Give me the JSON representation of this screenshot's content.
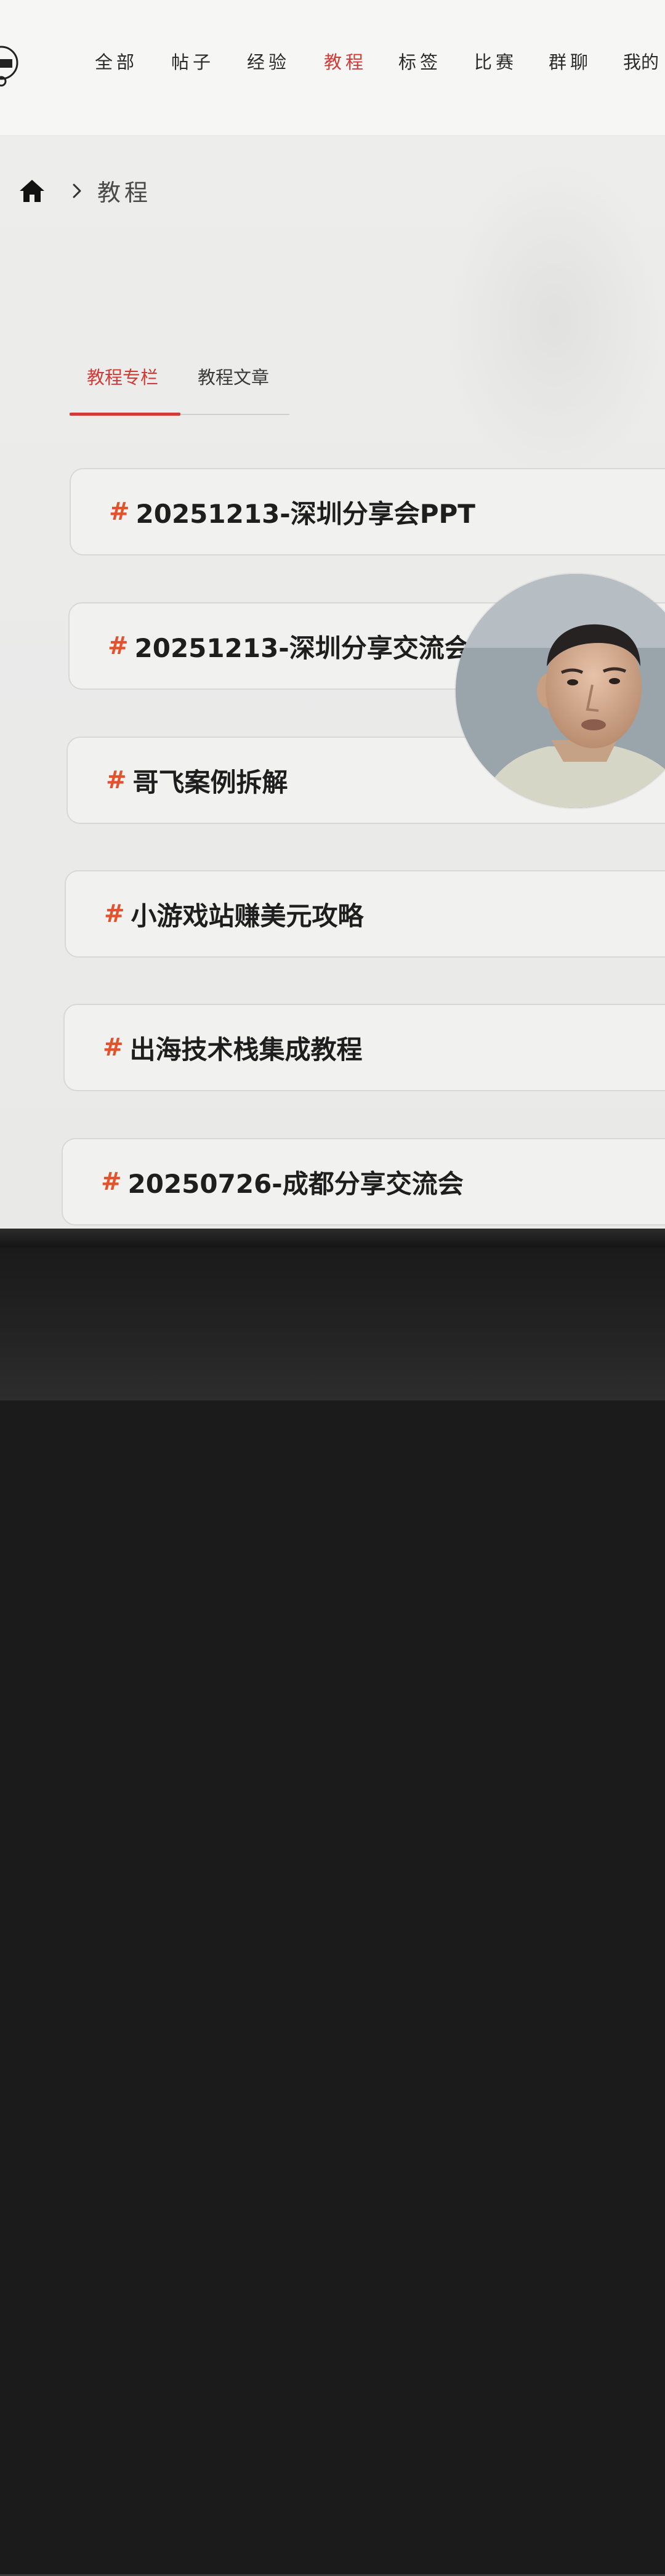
{
  "nav": {
    "items": [
      {
        "label": "全部",
        "active": false
      },
      {
        "label": "帖子",
        "active": false
      },
      {
        "label": "经验",
        "active": false
      },
      {
        "label": "教程",
        "active": true
      },
      {
        "label": "标签",
        "active": false
      },
      {
        "label": "比赛",
        "active": false
      },
      {
        "label": "群聊",
        "active": false
      },
      {
        "label": "我的",
        "active": false
      }
    ]
  },
  "breadcrumb": {
    "home_icon": "home-icon",
    "separator_icon": "chevron-right-icon",
    "current": "教程"
  },
  "tabs": [
    {
      "label": "教程专栏",
      "active": true
    },
    {
      "label": "教程文章",
      "active": false
    }
  ],
  "cards": [
    {
      "hash": "#",
      "title": "20251213-深圳分享会PPT"
    },
    {
      "hash": "#",
      "title": "20251213-深圳分享交流会"
    },
    {
      "hash": "#",
      "title": "哥飞案例拆解"
    },
    {
      "hash": "#",
      "title": "小游戏站赚美元攻略"
    },
    {
      "hash": "#",
      "title": "出海技术栈集成教程"
    },
    {
      "hash": "#",
      "title": "20250726-成都分享交流会"
    }
  ],
  "colors": {
    "accent": "#d13a36",
    "hash": "#e2532d",
    "text": "#1e1e1e"
  }
}
